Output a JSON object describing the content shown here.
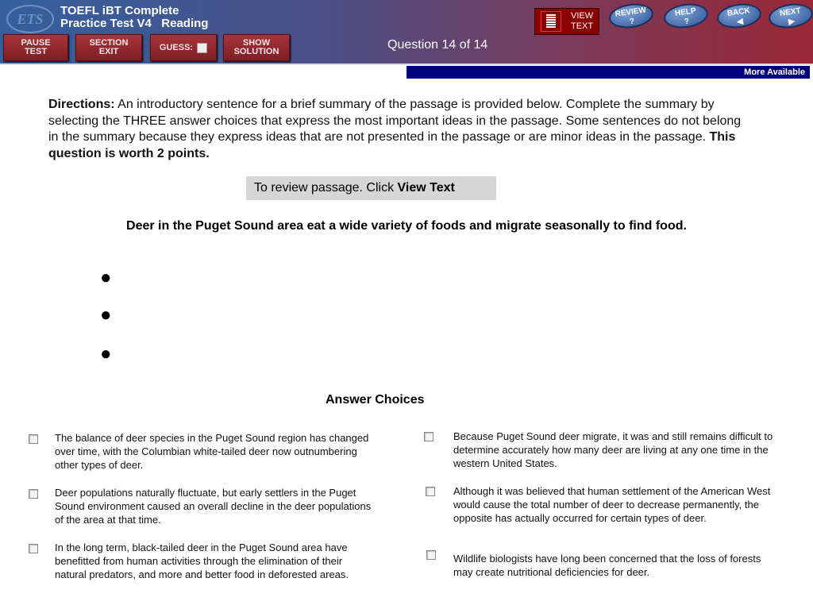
{
  "header": {
    "logo": "ETS",
    "title_line1": "TOEFL iBT Complete",
    "title_line2": "Practice Test V4   Reading",
    "question_counter": "Question 14 of 14",
    "buttons": {
      "pause": "PAUSE TEST",
      "section_exit": "SECTION EXIT",
      "guess": "GUESS:",
      "show_solution": "SHOW SOLUTION",
      "view_text": "VIEW TEXT",
      "review": "REVIEW",
      "help": "HELP",
      "back": "BACK",
      "next": "NEXT"
    },
    "more_available": "More Available"
  },
  "directions": {
    "label": "Directions:",
    "text": " An introductory sentence for a brief summary of the passage is provided below. Complete the summary by selecting the THREE answer choices that express the most important ideas in the passage. Some sentences do not belong in the summary because they express ideas that are not presented in the passage or are minor ideas in the passage. ",
    "emphasis": "This question is worth 2 points."
  },
  "review_prompt": {
    "text": "To review passage. Click ",
    "link": "View Text"
  },
  "topic_sentence": "Deer in the Puget Sound area eat a wide variety of foods and migrate seasonally to find food.",
  "answer_choices_heading": "Answer Choices",
  "choices_left": [
    "The balance of deer species in the Puget Sound region has changed over time, with the Columbian white-tailed deer now outnumbering other types of deer.",
    "Deer populations naturally fluctuate, but early settlers in the Puget Sound environment caused an overall decline in the deer populations of the area at that time.",
    "In the long term, black-tailed deer in the Puget Sound area have benefitted from human activities through the elimination of their natural predators, and more and better food in deforested areas."
  ],
  "choices_right": [
    "Because Puget Sound deer migrate, it was and still remains difficult to determine accurately how many deer are living at any one time in the western United States.",
    "Although it was believed that human settlement of the American West would cause the total number of deer to decrease permanently, the opposite has actually occurred for certain types of deer.",
    "Wildlife biologists have long been concerned that the loss of forests may create nutritional deficiencies for deer."
  ]
}
